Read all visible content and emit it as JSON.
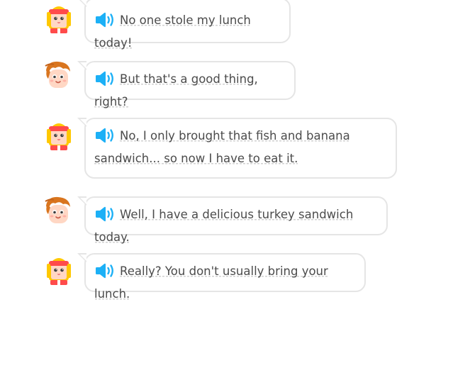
{
  "dialogue": [
    {
      "speaker": "girl",
      "text": "No one stole my lunch today!"
    },
    {
      "speaker": "boy",
      "text": "But that's a good thing, right?"
    },
    {
      "speaker": "girl",
      "text": "No, I only brought that fish and banana sandwich... so now I have to eat it."
    },
    {
      "speaker": "boy",
      "text": "Well, I have a delicious turkey sandwich today."
    },
    {
      "speaker": "girl",
      "text": "Really? You don't usually bring your lunch."
    }
  ],
  "icons": {
    "speaker": "speaker-icon",
    "avatar_girl": "girl-avatar-icon",
    "avatar_boy": "boy-avatar-icon"
  },
  "colors": {
    "speaker_blue": "#1cb0f6",
    "bubble_border": "#e5e5e5",
    "text": "#4b4b4b",
    "dotted_underline": "#d0d0d0"
  }
}
